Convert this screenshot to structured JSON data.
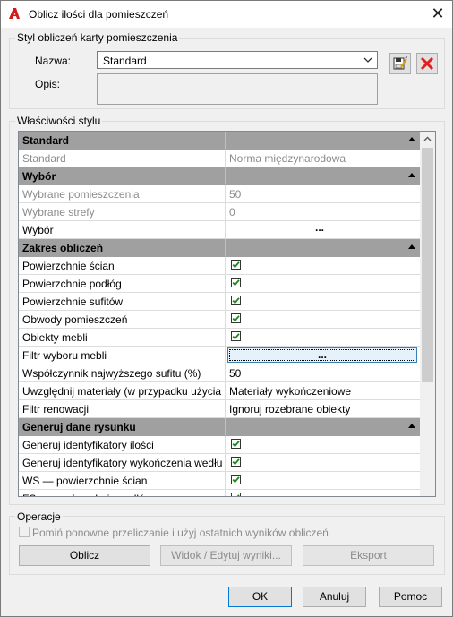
{
  "window": {
    "title": "Oblicz ilości dla pomieszczeń"
  },
  "style_group": {
    "label": "Styl obliczeń karty pomieszczenia",
    "name_label": "Nazwa:",
    "name_value": "Standard",
    "desc_label": "Opis:",
    "desc_value": ""
  },
  "properties_group": {
    "label": "Właściwości stylu"
  },
  "grid": {
    "rows": [
      {
        "type": "section",
        "name": "Standard"
      },
      {
        "type": "text",
        "name": "Standard",
        "value": "Norma międzynarodowa",
        "disabled": true
      },
      {
        "type": "section",
        "name": "Wybór"
      },
      {
        "type": "text",
        "name": "Wybrane pomieszczenia",
        "value": "50",
        "disabled": true
      },
      {
        "type": "text",
        "name": "Wybrane strefy",
        "value": "0",
        "disabled": true
      },
      {
        "type": "dots",
        "name": "Wybór",
        "value": "..."
      },
      {
        "type": "section",
        "name": "Zakres obliczeń"
      },
      {
        "type": "check",
        "name": "Powierzchnie ścian",
        "checked": true
      },
      {
        "type": "check",
        "name": "Powierzchnie podłóg",
        "checked": true
      },
      {
        "type": "check",
        "name": "Powierzchnie sufitów",
        "checked": true
      },
      {
        "type": "check",
        "name": "Obwody pomieszczeń",
        "checked": true
      },
      {
        "type": "check",
        "name": "Obiekty mebli",
        "checked": true
      },
      {
        "type": "dotbtn",
        "name": "Filtr wyboru mebli",
        "value": "..."
      },
      {
        "type": "text",
        "name": "Współczynnik najwyższego sufitu (%)",
        "value": "50"
      },
      {
        "type": "text",
        "name": "Uwzględnij materiały (w przypadku użycia",
        "value": "Materiały wykończeniowe"
      },
      {
        "type": "text",
        "name": "Filtr renowacji",
        "value": "Ignoruj rozebrane obiekty"
      },
      {
        "type": "section",
        "name": "Generuj dane rysunku"
      },
      {
        "type": "check",
        "name": "Generuj identyfikatory ilości",
        "checked": true
      },
      {
        "type": "check",
        "name": "Generuj identyfikatory wykończenia wedłu",
        "checked": true
      },
      {
        "type": "check",
        "name": "WS — powierzchnie ścian",
        "checked": true
      },
      {
        "type": "check",
        "name": "FS — powierzchnie podłóg",
        "checked": true
      }
    ]
  },
  "operations": {
    "label": "Operacje",
    "skip_label": "Pomiń ponowne przeliczanie i użyj ostatnich wyników obliczeń",
    "compute": "Oblicz",
    "view_edit": "Widok / Edytuj wyniki...",
    "export": "Eksport"
  },
  "footer": {
    "ok": "OK",
    "cancel": "Anuluj",
    "help": "Pomoc"
  }
}
